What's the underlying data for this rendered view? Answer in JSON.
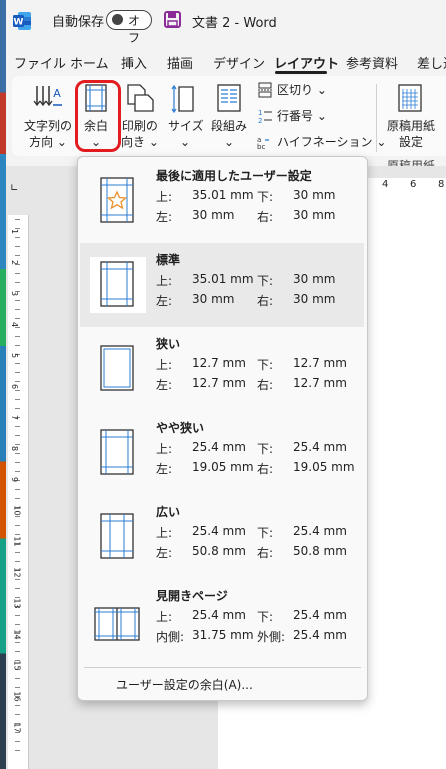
{
  "titlebar": {
    "autosave_label": "自動保存",
    "toggle_state": "オフ",
    "doc_title": "文書 2  -  Word",
    "logo_icon": "word-logo-icon",
    "save_icon": "save-icon"
  },
  "tabs": [
    "ファイル",
    "ホーム",
    "挿入",
    "描画",
    "デザイン",
    "レイアウト",
    "参考資料",
    "差し込"
  ],
  "active_tab": "レイアウト",
  "ribbon": {
    "text_direction": [
      "文字列の",
      "方向 ⌄"
    ],
    "margins": [
      "余白",
      "⌄"
    ],
    "orientation": [
      "印刷の",
      "向き ⌄"
    ],
    "size": [
      "サイズ",
      "⌄"
    ],
    "columns": [
      "段組み",
      "⌄"
    ],
    "breaks": "区切り ⌄",
    "line_numbers": "行番号 ⌄",
    "hyphenation": "ハイフネーション ⌄",
    "manuscript": [
      "原稿用紙",
      "設定"
    ],
    "manuscript_group": "原稿用紙"
  },
  "ruler_top": [
    "4",
    "6",
    "8"
  ],
  "vruler_numbers": [
    "1",
    "2",
    "3",
    "4",
    "5",
    "6",
    "7",
    "8",
    "9",
    "10",
    "11",
    "12",
    "13",
    "14",
    "15",
    "16",
    "17"
  ],
  "margins_menu": {
    "items": [
      {
        "title": "最後に適用したユーザー設定",
        "top_label": "上:",
        "top": "35.01 mm",
        "bottom_label": "下:",
        "bottom": "30 mm",
        "left_label": "左:",
        "left": "30 mm",
        "right_label": "右:",
        "right": "30 mm",
        "icon": "star-margin-icon"
      },
      {
        "title": "標準",
        "top_label": "上:",
        "top": "35.01 mm",
        "bottom_label": "下:",
        "bottom": "30 mm",
        "left_label": "左:",
        "left": "30 mm",
        "right_label": "右:",
        "right": "30 mm",
        "icon": "normal-margin-icon"
      },
      {
        "title": "狭い",
        "top_label": "上:",
        "top": "12.7 mm",
        "bottom_label": "下:",
        "bottom": "12.7 mm",
        "left_label": "左:",
        "left": "12.7 mm",
        "right_label": "右:",
        "right": "12.7 mm",
        "icon": "narrow-margin-icon"
      },
      {
        "title": "やや狭い",
        "top_label": "上:",
        "top": "25.4 mm",
        "bottom_label": "下:",
        "bottom": "25.4 mm",
        "left_label": "左:",
        "left": "19.05 mm",
        "right_label": "右:",
        "right": "19.05 mm",
        "icon": "moderate-margin-icon"
      },
      {
        "title": "広い",
        "top_label": "上:",
        "top": "25.4 mm",
        "bottom_label": "下:",
        "bottom": "25.4 mm",
        "left_label": "左:",
        "left": "50.8 mm",
        "right_label": "右:",
        "right": "50.8 mm",
        "icon": "wide-margin-icon"
      },
      {
        "title": "見開きページ",
        "top_label": "上:",
        "top": "25.4 mm",
        "bottom_label": "下:",
        "bottom": "25.4 mm",
        "left_label": "内側:",
        "left": "31.75 mm",
        "right_label": "外側:",
        "right": "25.4 mm",
        "icon": "mirrored-margin-icon"
      }
    ],
    "custom_margins": "ユーザー設定の余白(A)..."
  },
  "colors": {
    "highlight": "#e21c21",
    "word_blue": "#185abd",
    "save_purple": "#8a2a96"
  }
}
